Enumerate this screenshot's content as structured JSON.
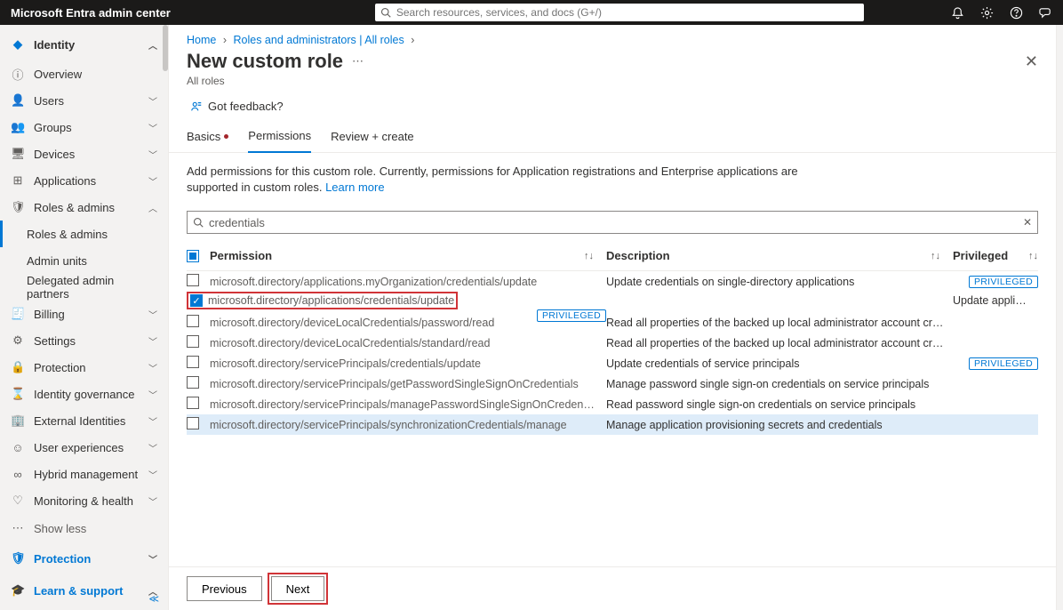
{
  "brand": "Microsoft Entra admin center",
  "global_search_placeholder": "Search resources, services, and docs (G+/)",
  "sidebar": {
    "identity": "Identity",
    "overview": "Overview",
    "users": "Users",
    "groups": "Groups",
    "devices": "Devices",
    "applications": "Applications",
    "roles_admins": "Roles & admins",
    "roles_admins_sub": "Roles & admins",
    "admin_units": "Admin units",
    "delegated": "Delegated admin partners",
    "billing": "Billing",
    "settings": "Settings",
    "protection": "Protection",
    "identity_gov": "Identity governance",
    "external": "External Identities",
    "user_exp": "User experiences",
    "hybrid": "Hybrid management",
    "monitoring": "Monitoring & health",
    "show_less": "Show less",
    "protection_section": "Protection",
    "learn": "Learn & support"
  },
  "breadcrumb": {
    "home": "Home",
    "roles": "Roles and administrators | All roles"
  },
  "page": {
    "title": "New custom role",
    "subtitle": "All roles"
  },
  "feedback": "Got feedback?",
  "tabs": {
    "basics": "Basics",
    "permissions": "Permissions",
    "review": "Review + create"
  },
  "description": {
    "text": "Add permissions for this custom role. Currently, permissions for Application registrations and Enterprise applications are supported in custom roles. ",
    "learn": "Learn more"
  },
  "filter_value": "credentials",
  "columns": {
    "permission": "Permission",
    "description": "Description",
    "privileged": "Privileged",
    "priv_badge": "PRIVILEGED"
  },
  "rows": [
    {
      "perm": "microsoft.directory/applications.myOrganization/credentials/update",
      "desc": "Update credentials on single-directory applications",
      "priv": true,
      "checked": false
    },
    {
      "perm": "microsoft.directory/applications/credentials/update",
      "desc": "Update application credentials",
      "priv": true,
      "checked": true,
      "highlight": true
    },
    {
      "perm": "microsoft.directory/deviceLocalCredentials/password/read",
      "desc": "Read all properties of the backed up local administrator account credentials for Microsoft Entra joi...",
      "priv": false,
      "checked": false
    },
    {
      "perm": "microsoft.directory/deviceLocalCredentials/standard/read",
      "desc": "Read all properties of the backed up local administrator account credentials for Microsoft Entra joi...",
      "priv": false,
      "checked": false
    },
    {
      "perm": "microsoft.directory/servicePrincipals/credentials/update",
      "desc": "Update credentials of service principals",
      "priv": true,
      "checked": false
    },
    {
      "perm": "microsoft.directory/servicePrincipals/getPasswordSingleSignOnCredentials",
      "desc": "Manage password single sign-on credentials on service principals",
      "priv": false,
      "checked": false
    },
    {
      "perm": "microsoft.directory/servicePrincipals/managePasswordSingleSignOnCredentials",
      "desc": "Read password single sign-on credentials on service principals",
      "priv": false,
      "checked": false
    },
    {
      "perm": "microsoft.directory/servicePrincipals/synchronizationCredentials/manage",
      "desc": "Manage application provisioning secrets and credentials",
      "priv": false,
      "checked": false,
      "hover": true
    }
  ],
  "footer": {
    "prev": "Previous",
    "next": "Next"
  }
}
